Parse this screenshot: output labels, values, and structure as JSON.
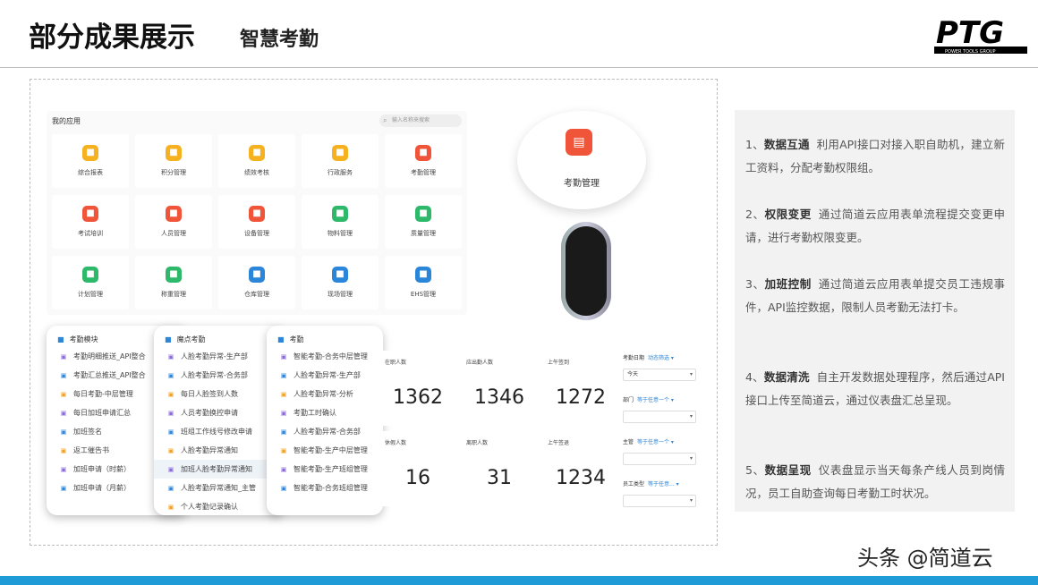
{
  "header": {
    "title": "部分成果展示",
    "subtitle": "智慧考勤",
    "logo_text": "PTG",
    "logo_sub": "POWER TOOLS GROUP"
  },
  "apps": {
    "heading": "我的应用",
    "search_placeholder": "输入名称来搜索",
    "items": [
      {
        "label": "综合报表",
        "color": "#f5b120",
        "icon": "chart-icon"
      },
      {
        "label": "积分管理",
        "color": "#f5b120",
        "icon": "points-icon"
      },
      {
        "label": "绩效考核",
        "color": "#f5b120",
        "icon": "check-icon"
      },
      {
        "label": "行政服务",
        "color": "#f5b120",
        "icon": "service-icon"
      },
      {
        "label": "考勤管理",
        "color": "#f0553a",
        "icon": "attendance-icon"
      },
      {
        "label": "考试培训",
        "color": "#f0553a",
        "icon": "training-icon"
      },
      {
        "label": "人员管理",
        "color": "#f0553a",
        "icon": "people-icon"
      },
      {
        "label": "设备管理",
        "color": "#f0553a",
        "icon": "device-icon"
      },
      {
        "label": "物料管理",
        "color": "#2db86a",
        "icon": "material-icon"
      },
      {
        "label": "质量管理",
        "color": "#2db86a",
        "icon": "quality-icon"
      },
      {
        "label": "计划管理",
        "color": "#2db86a",
        "icon": "plan-icon"
      },
      {
        "label": "称重管理",
        "color": "#2db86a",
        "icon": "weigh-icon"
      },
      {
        "label": "仓库管理",
        "color": "#2b86d9",
        "icon": "warehouse-icon"
      },
      {
        "label": "现场管理",
        "color": "#2b86d9",
        "icon": "site-icon"
      },
      {
        "label": "EHS管理",
        "color": "#2b86d9",
        "icon": "ehs-icon"
      }
    ]
  },
  "bubble": {
    "label": "考勤管理"
  },
  "panel1": {
    "title": "考勤模块",
    "items": [
      "考勤明细推送_API整合",
      "考勤汇总推送_API整合",
      "每日考勤-中层管理",
      "每日加班申请汇总",
      "加班签名",
      "返工催告书",
      "加班申请（时薪）",
      "加班申请（月薪）"
    ]
  },
  "panel2": {
    "title": "魔点考勤",
    "items": [
      "人脸考勤异常-生产部",
      "人脸考勤异常-合务部",
      "每日人脸签到人数",
      "人员考勤换控申请",
      "班组工作线号修改申请",
      "人脸考勤异常通知",
      "加班人脸考勤异常通知",
      "人脸考勤异常通知_主管",
      "个人考勤记录确认"
    ]
  },
  "panel3": {
    "title": "考勤",
    "items": [
      "智能考勤-合务中层管理",
      "人脸考勤异常-生产部",
      "人脸考勤异常-分析",
      "考勤工时确认",
      "人脸考勤异常-合务部",
      "智能考勤-生产中层管理",
      "智能考勤-生产班组管理",
      "智能考勤-合务班组管理"
    ]
  },
  "stats": [
    {
      "label": "在职人数",
      "value": "1362"
    },
    {
      "label": "应出勤人数",
      "value": "1346"
    },
    {
      "label": "上午签到",
      "value": "1272"
    },
    {
      "label": "休假人数",
      "value": "16"
    },
    {
      "label": "离职人数",
      "value": "31"
    },
    {
      "label": "上午签退",
      "value": "1234"
    }
  ],
  "filters": [
    {
      "label": "考勤日期",
      "link": "动态筛选 ▾",
      "value": "今天"
    },
    {
      "label": "部门",
      "link": "等于任意一个 ▾",
      "value": ""
    },
    {
      "label": "主管",
      "link": "等于任意一个 ▾",
      "value": ""
    },
    {
      "label": "员工类型",
      "link": "等于任意... ▾",
      "value": ""
    }
  ],
  "points": [
    {
      "num": "1、",
      "title": "数据互通",
      "text": "利用API接口对接入职自助机，建立新工资料，分配考勤权限组。"
    },
    {
      "num": "2、",
      "title": "权限变更",
      "text": "通过简道云应用表单流程提交变更申请，进行考勤权限变更。"
    },
    {
      "num": "3、",
      "title": "加班控制",
      "text": "通过简道云应用表单提交员工违规事件，API监控数据，限制人员考勤无法打卡。"
    },
    {
      "num": "4、",
      "title": "数据清洗",
      "text": "自主开发数据处理程序，然后通过API接口上传至简道云，通过仪表盘汇总呈现。"
    },
    {
      "num": "5、",
      "title": "数据呈现",
      "text": "仪表盘显示当天每条产线人员到岗情况，员工自助查询每日考勤工时状况。"
    }
  ],
  "watermark": "头条 @简道云",
  "colors": {
    "accent": "#1f9bd7",
    "orange": "#f5b120",
    "red": "#f0553a",
    "green": "#2db86a",
    "blue": "#2b86d9"
  }
}
